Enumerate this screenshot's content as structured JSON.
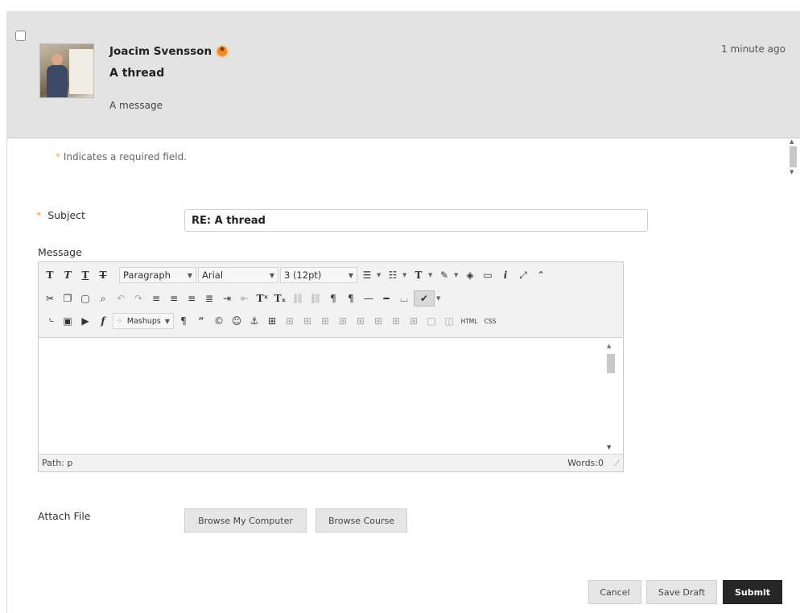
{
  "post": {
    "author": "Joacim Svensson",
    "title": "A thread",
    "message": "A message",
    "timestamp": "1 minute ago"
  },
  "form": {
    "required_note": "Indicates a required field.",
    "required_star": "*",
    "subject_label": "Subject",
    "subject_value": "RE: A thread",
    "message_label": "Message",
    "attach_label": "Attach File",
    "browse_computer": "Browse My Computer",
    "browse_course": "Browse Course",
    "cancel": "Cancel",
    "save_draft": "Save Draft",
    "submit": "Submit"
  },
  "editor": {
    "format_select": "Paragraph",
    "font_select": "Arial",
    "size_select": "3 (12pt)",
    "mashups": "Mashups",
    "html_btn": "HTML",
    "css_btn": "CSS",
    "path": "Path: p",
    "words": "Words:0"
  },
  "colors": {
    "header_bg": "#e3e3e3",
    "required_star": "#e8a33c",
    "submit_bg": "#262626"
  }
}
